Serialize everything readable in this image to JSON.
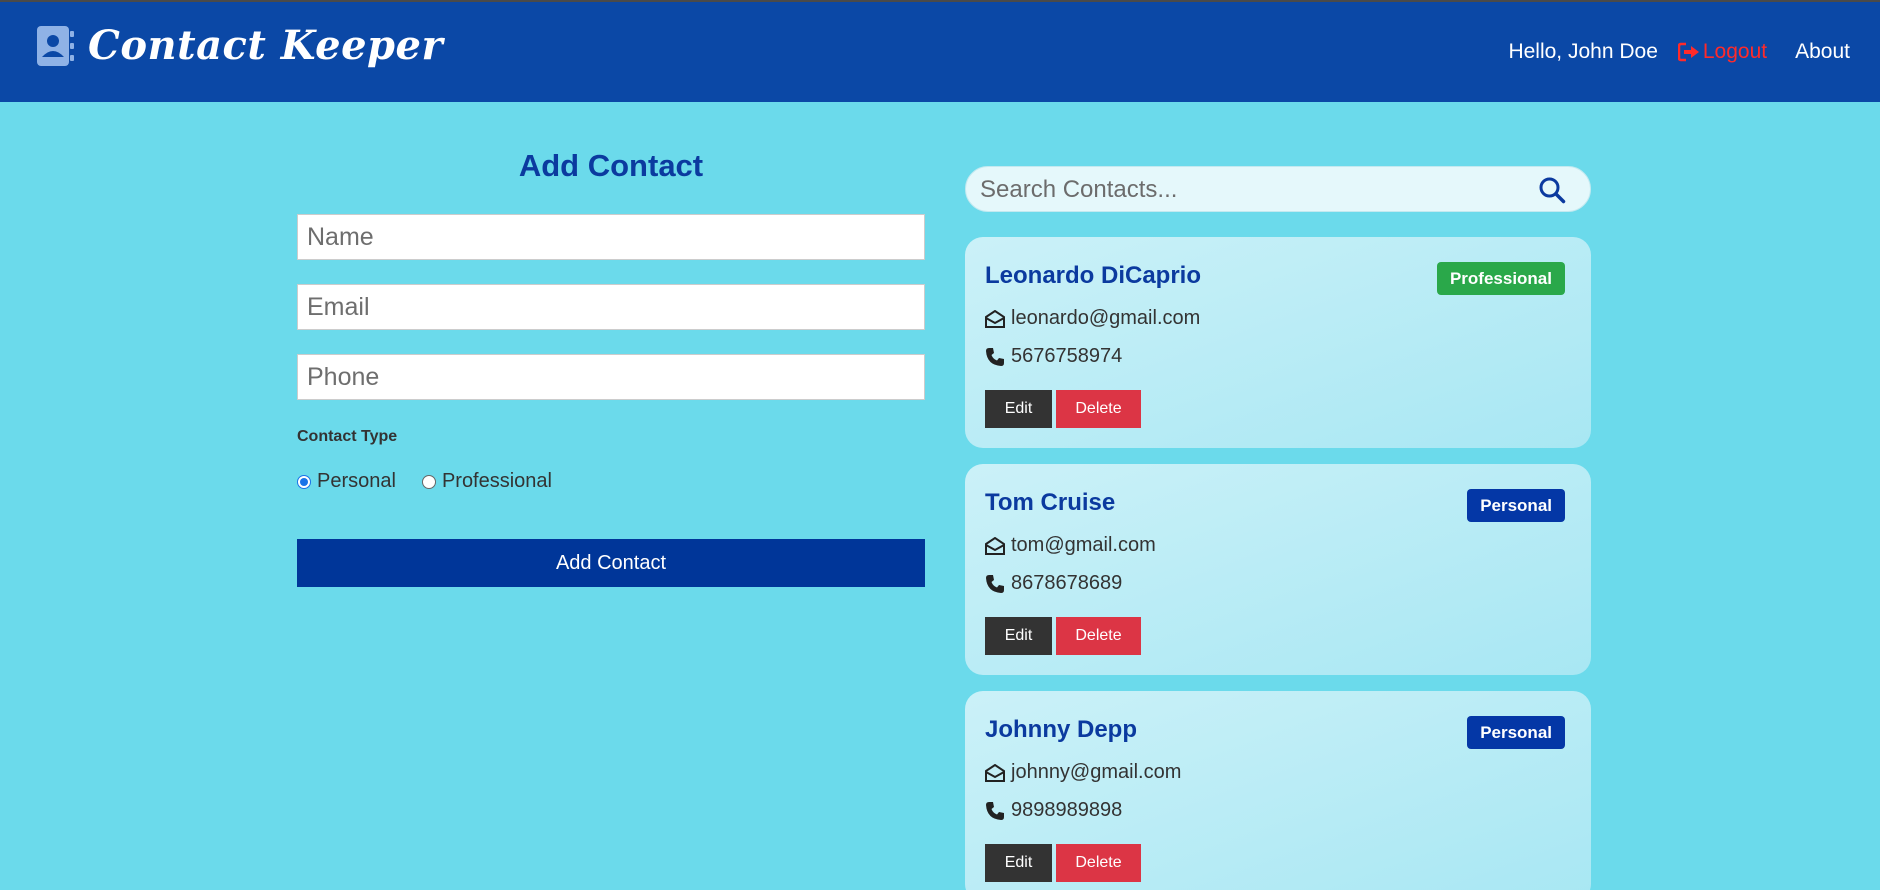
{
  "app": {
    "title": "Contact Keeper",
    "icon": "address-book-icon"
  },
  "nav": {
    "greeting": "Hello, John Doe",
    "logout_label": "Logout",
    "about_label": "About"
  },
  "form": {
    "title": "Add Contact",
    "name_placeholder": "Name",
    "email_placeholder": "Email",
    "phone_placeholder": "Phone",
    "contact_type_label": "Contact Type",
    "type_options": [
      {
        "label": "Personal",
        "selected": true
      },
      {
        "label": "Professional",
        "selected": false
      }
    ],
    "submit_label": "Add Contact"
  },
  "search": {
    "placeholder": "Search Contacts..."
  },
  "contacts": [
    {
      "name": "Leonardo DiCaprio",
      "type": "Professional",
      "email": "leonardo@gmail.com",
      "phone": "5676758974"
    },
    {
      "name": "Tom Cruise",
      "type": "Personal",
      "email": "tom@gmail.com",
      "phone": "8678678689"
    },
    {
      "name": "Johnny Depp",
      "type": "Personal",
      "email": "johnny@gmail.com",
      "phone": "9898989898"
    }
  ],
  "card_buttons": {
    "edit": "Edit",
    "delete": "Delete"
  },
  "colors": {
    "navbar": "#0b48a6",
    "background": "#6bdaeb",
    "primary": "#003699",
    "professional_badge": "#2aa84a",
    "personal_badge": "#0437a6",
    "delete": "#dc3545",
    "logout": "#ff2a2a"
  }
}
